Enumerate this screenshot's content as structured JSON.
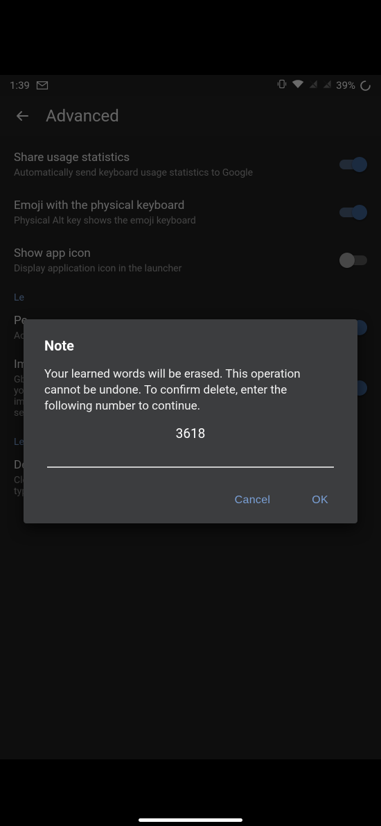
{
  "status": {
    "time": "1:39",
    "battery": "39%"
  },
  "appbar": {
    "title": "Advanced"
  },
  "settings": {
    "row0": {
      "title": "Share usage statistics",
      "sub": "Automatically send keyboard usage statistics to Google"
    },
    "row1": {
      "title": "Emoji with the physical keyboard",
      "sub": "Physical Alt key shows the emoji keyboard"
    },
    "row2": {
      "title": "Show app icon",
      "sub": "Display application icon in the launcher"
    },
    "cat0": "Le",
    "row3": {
      "title": "Pe",
      "sub": "Ac"
    },
    "row4": {
      "title": "Im",
      "sub": "Gb\nyo\nim\nse"
    },
    "cat1": "Le",
    "row5": {
      "title": "Delete learned words and data",
      "sub": "Clear all on-device data that Gboard has saved to improve your typing and voice typing experience"
    }
  },
  "dialog": {
    "title": "Note",
    "body": "Your learned words will be erased. This operation cannot be undone. To confirm delete, enter the following number to continue.",
    "code": "3618",
    "cancel": "Cancel",
    "ok": "OK"
  }
}
